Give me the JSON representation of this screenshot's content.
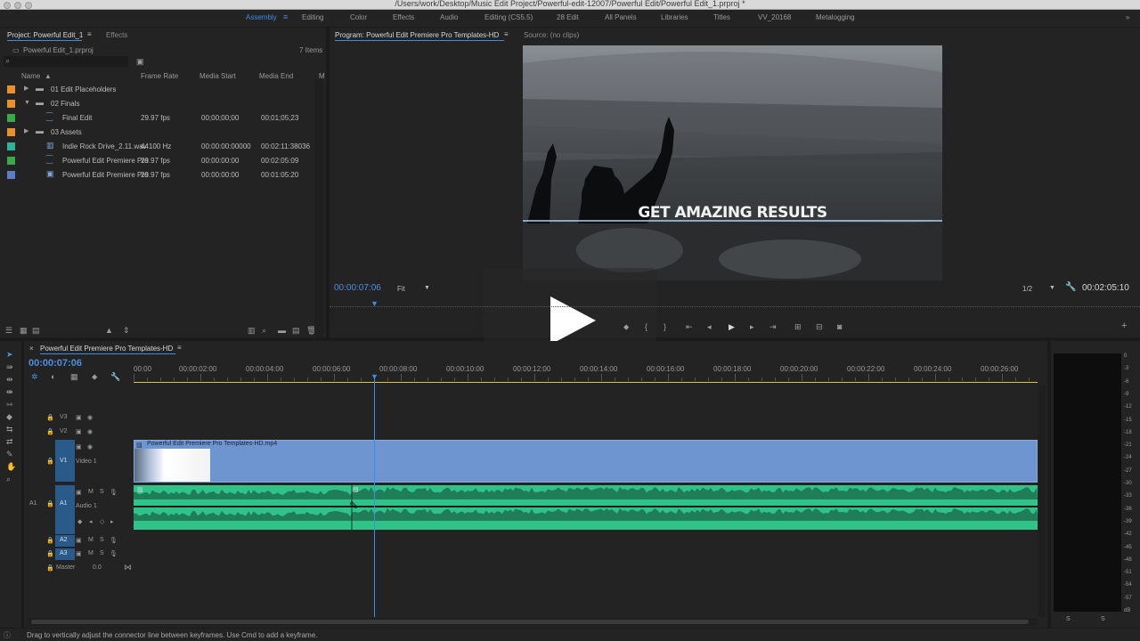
{
  "window": {
    "title": "/Users/work/Desktop/Music Edit Project/Powerful-edit-12007/Powerful Edit/Powerful Edit_1.prproj *"
  },
  "workspaces": [
    {
      "label": "Assembly",
      "active": true
    },
    {
      "label": "Editing"
    },
    {
      "label": "Color"
    },
    {
      "label": "Effects"
    },
    {
      "label": "Audio"
    },
    {
      "label": "Editing (CS5.5)"
    },
    {
      "label": "28 Edit"
    },
    {
      "label": "All Panels"
    },
    {
      "label": "Libraries"
    },
    {
      "label": "Titles"
    },
    {
      "label": "VV_20168"
    },
    {
      "label": "Metalogging"
    }
  ],
  "project": {
    "tab": "Project: Powerful Edit_1",
    "effects_tab": "Effects",
    "file": "Powerful Edit_1.prproj",
    "count": "7 Items",
    "columns": {
      "name": "Name",
      "frame_rate": "Frame Rate",
      "media_start": "Media Start",
      "media_end": "Media End",
      "more": "M"
    },
    "items": [
      {
        "name": "01 Edit Placeholders",
        "color": "#e8902c",
        "kind": "folder",
        "expand": "closed",
        "frame_rate": "",
        "media_start": "",
        "media_end": ""
      },
      {
        "name": "02 Finals",
        "color": "#e8902c",
        "kind": "folder",
        "expand": "open",
        "frame_rate": "",
        "media_start": "",
        "media_end": ""
      },
      {
        "name": "Final Edit",
        "color": "#3aa94a",
        "kind": "sequence",
        "expand": "",
        "frame_rate": "29.97 fps",
        "media_start": "00;00;00;00",
        "media_end": "00;01;05;23"
      },
      {
        "name": "03 Assets",
        "color": "#e8902c",
        "kind": "folder",
        "expand": "closed",
        "frame_rate": "",
        "media_start": "",
        "media_end": ""
      },
      {
        "name": "Indie Rock Drive_2.11.wav",
        "color": "#2fb39a",
        "kind": "audio",
        "expand": "",
        "frame_rate": "44100 Hz",
        "media_start": "00:00:00:00000",
        "media_end": "00:02:11:38036"
      },
      {
        "name": "Powerful Edit Premiere Pro",
        "color": "#3aa94a",
        "kind": "sequence",
        "expand": "",
        "frame_rate": "29.97 fps",
        "media_start": "00:00:00:00",
        "media_end": "00:02:05:09"
      },
      {
        "name": "Powerful Edit Premiere Pro",
        "color": "#5b7fc7",
        "kind": "clip",
        "expand": "",
        "frame_rate": "29.97 fps",
        "media_start": "00:00:00:00",
        "media_end": "00:01:05:20"
      }
    ]
  },
  "program": {
    "tab": "Program: Powerful Edit Premiere Pro Templates-HD",
    "source_tab": "Source: (no clips)",
    "overlay_text": "GET AMAZING RESULTS",
    "timecode": "00:00:07:06",
    "fit": "Fit",
    "resolution": "1/2",
    "duration": "00:02:05:10"
  },
  "timeline": {
    "tab": "Powerful Edit Premiere Pro Templates-HD",
    "timecode": "00:00:07:06",
    "ruler": [
      "00:00",
      "00:00:02:00",
      "00:00:04:00",
      "00:00:06:00",
      "00:00:08:00",
      "00:00:10:00",
      "00:00:12:00",
      "00:00:14:00",
      "00:00:16:00",
      "00:00:18:00",
      "00:00:20:00",
      "00:00:22:00",
      "00:00:24:00",
      "00:00:26:00"
    ],
    "tracks": {
      "v3": "V3",
      "v2": "V2",
      "v1": "V1",
      "v1_name": "Video 1",
      "a1_src": "A1",
      "a1": "A1",
      "a1_name": "Audio 1",
      "a2": "A2",
      "a3": "A3",
      "master": "Master",
      "master_val": "0.0",
      "m": "M",
      "s": "S"
    },
    "clip_name": "Powerful Edit Premiere Pro Templates-HD.mp4",
    "playhead_seconds": 7.2
  },
  "meter": {
    "scale": [
      "0",
      "-3",
      "-6",
      "-9",
      "-12",
      "-15",
      "-18",
      "-21",
      "-24",
      "-27",
      "-30",
      "-33",
      "-36",
      "-39",
      "-42",
      "-45",
      "-48",
      "-51",
      "-54",
      "-57",
      "dB"
    ],
    "s1": "S",
    "s2": "S"
  },
  "status": "Drag to vertically adjust the connector line between keyframes. Use Cmd to add a keyframe.",
  "colors": {
    "accent": "#3a8ee6",
    "video_clip": "#6e95d0",
    "audio_clip": "#2fc38a",
    "folder": "#e8902c"
  }
}
